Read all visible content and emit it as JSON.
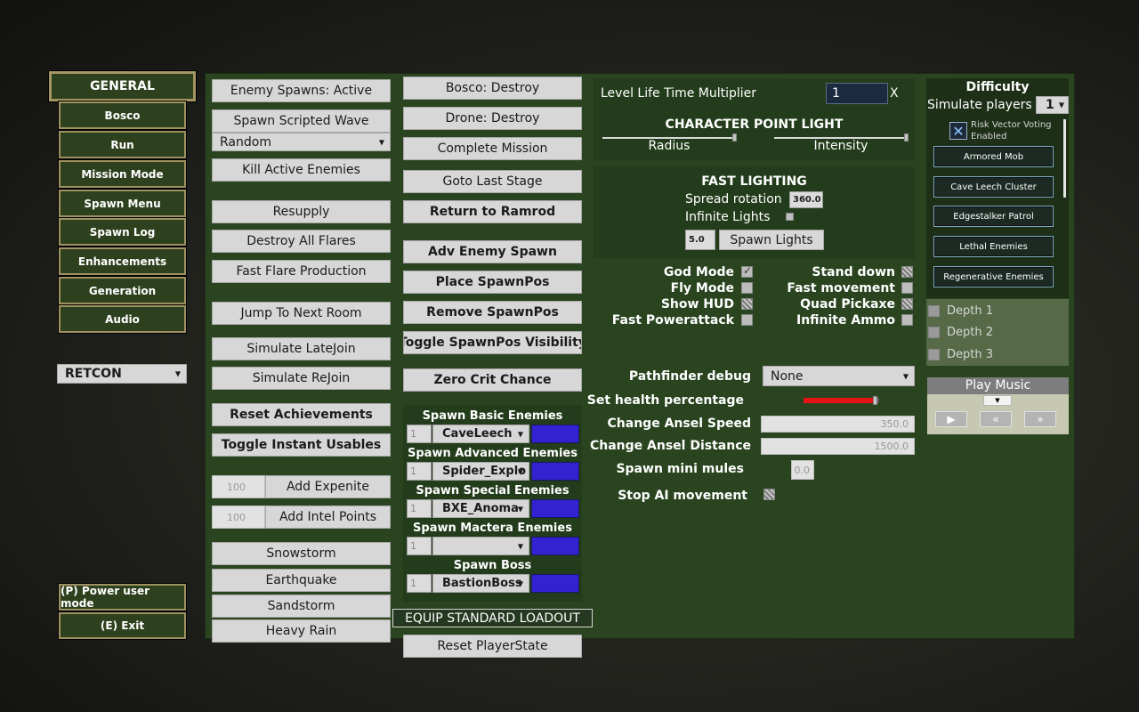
{
  "nav": {
    "items": [
      "GENERAL",
      "Bosco",
      "Run",
      "Mission Mode",
      "Spawn Menu",
      "Spawn Log",
      "Enhancements",
      "Generation",
      "Audio"
    ],
    "preset": "RETCON",
    "power_user": "(P) Power user mode",
    "exit": "(E) Exit"
  },
  "col1": {
    "enemy_spawns": "Enemy Spawns: Active",
    "spawn_wave": "Spawn Scripted Wave",
    "wave_select": "Random",
    "kill": "Kill Active Enemies",
    "resupply": "Resupply",
    "destroy_flares": "Destroy All Flares",
    "fast_flare": "Fast Flare Production",
    "jump": "Jump To Next Room",
    "latejoin": "Simulate LateJoin",
    "rejoin": "Simulate ReJoin",
    "reset_ach": "Reset Achievements",
    "toggle_usables": "Toggle Instant Usables",
    "xp_value": "100",
    "add_xp": "Add Expenite",
    "intel_value": "100",
    "add_intel": "Add Intel Points",
    "snowstorm": "Snowstorm",
    "earthquake": "Earthquake",
    "sandstorm": "Sandstorm",
    "rain": "Heavy Rain"
  },
  "col2": {
    "bosco_destroy": "Bosco: Destroy",
    "drone_destroy": "Drone: Destroy",
    "complete": "Complete Mission",
    "goto_last": "Goto Last Stage",
    "ramrod": "Return to Ramrod",
    "adv_spawn": "Adv Enemy Spawn",
    "place_pos": "Place SpawnPos",
    "remove_pos": "Remove SpawnPos",
    "toggle_pos": "Toggle SpawnPos Visibility",
    "zero_crit": "Zero Crit Chance",
    "spawn_groups": [
      {
        "title": "Spawn Basic Enemies",
        "count": "1",
        "enemy": "CaveLeech",
        "color": "#3222d2"
      },
      {
        "title": "Spawn Advanced Enemies",
        "count": "1",
        "enemy": "Spider_Explo",
        "color": "#3222d2"
      },
      {
        "title": "Spawn Special Enemies",
        "count": "1",
        "enemy": "BXE_Anoma",
        "color": "#3222d2"
      },
      {
        "title": "Spawn Mactera Enemies",
        "count": "1",
        "enemy": "",
        "color": "#3222d2"
      },
      {
        "title": "Spawn Boss",
        "count": "1",
        "enemy": "BastionBoss",
        "color": "#3222d2"
      }
    ],
    "equip": "EQUIP STANDARD LOADOUT",
    "reset_player": "Reset PlayerState"
  },
  "col3": {
    "life_label": "Level Life Time Multiplier",
    "life_value": "1",
    "life_suffix": "X",
    "cpl_title": "CHARACTER POINT LIGHT",
    "radius": "Radius",
    "intensity": "Intensity",
    "fl_title": "FAST LIGHTING",
    "spread_label": "Spread rotation",
    "spread_value": "360.0",
    "infinite_lights": "Infinite Lights",
    "light_count": "5.0",
    "spawn_lights": "Spawn Lights",
    "toggles_left": [
      "God Mode",
      "Fly Mode",
      "Show HUD",
      "Fast Powerattack"
    ],
    "toggles_right": [
      "Stand down",
      "Fast movement",
      "Quad Pickaxe",
      "Infinite Ammo"
    ],
    "pathfinder_label": "Pathfinder debug",
    "pathfinder_value": "None",
    "health_label": "Set health percentage",
    "health_fraction": 0.95,
    "ansel_speed_label": "Change Ansel Speed",
    "ansel_speed_value": "350.0",
    "ansel_dist_label": "Change Ansel Distance",
    "ansel_dist_value": "1500.0",
    "mini_mules_label": "Spawn mini mules",
    "mini_mules_value": "0.0",
    "stop_ai": "Stop AI movement"
  },
  "right": {
    "difficulty_title": "Difficulty",
    "sim_players_label": "Simulate players",
    "sim_players_value": "1",
    "risk_vector": "Risk Vector Voting Enabled",
    "enemies": [
      "Armored Mob",
      "Cave Leech Cluster",
      "Edgestalker Patrol",
      "Lethal Enemies",
      "Regenerative Enemies"
    ],
    "depths": [
      "Depth 1",
      "Depth 2",
      "Depth 3"
    ],
    "music_title": "Play Music"
  }
}
